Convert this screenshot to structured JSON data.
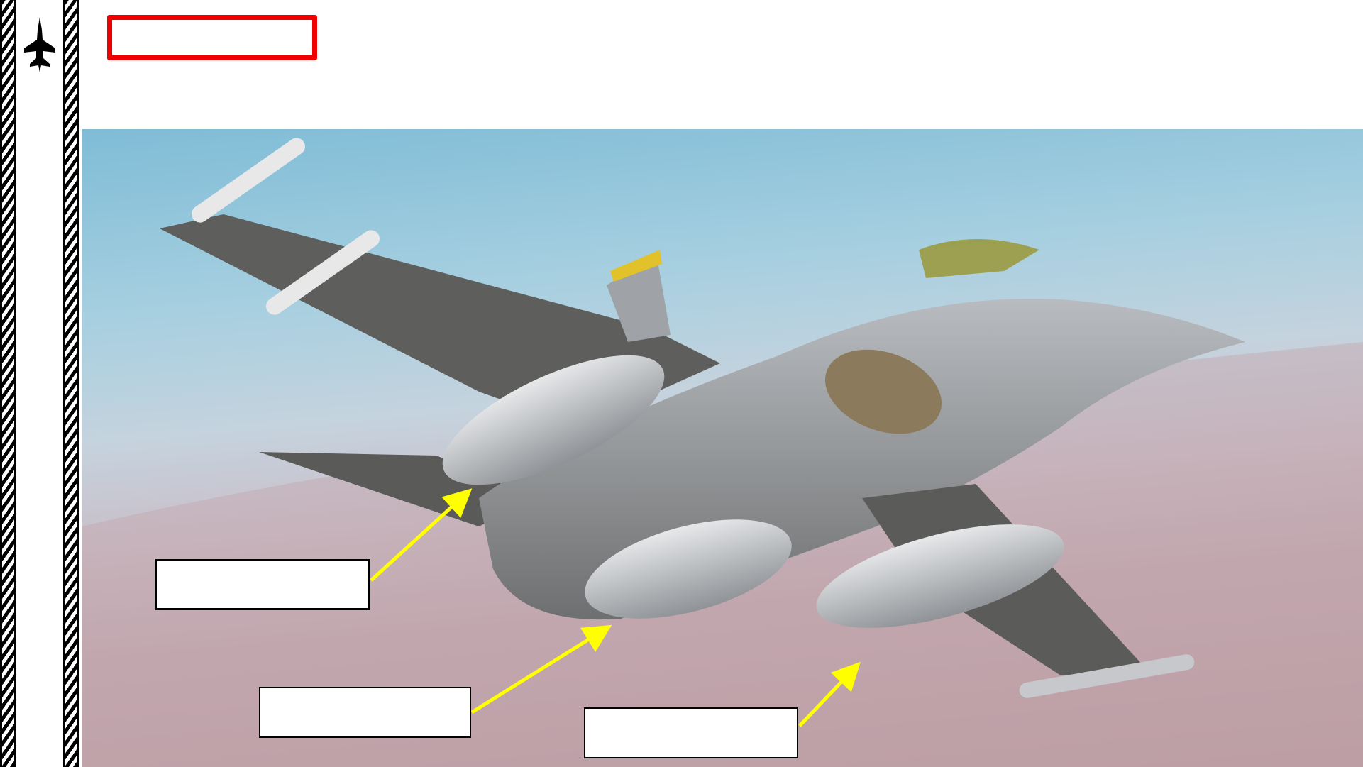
{
  "header": {
    "logo_icon": "fighter-jet-silhouette-icon",
    "title_box_border_color": "#f00000",
    "title": ""
  },
  "photo": {
    "subject": "aircraft-with-external-fuel-tanks"
  },
  "callouts": [
    {
      "label": "",
      "arrow_color": "#ffff00"
    },
    {
      "label": "",
      "arrow_color": "#ffff00"
    },
    {
      "label": "",
      "arrow_color": "#ffff00"
    }
  ]
}
